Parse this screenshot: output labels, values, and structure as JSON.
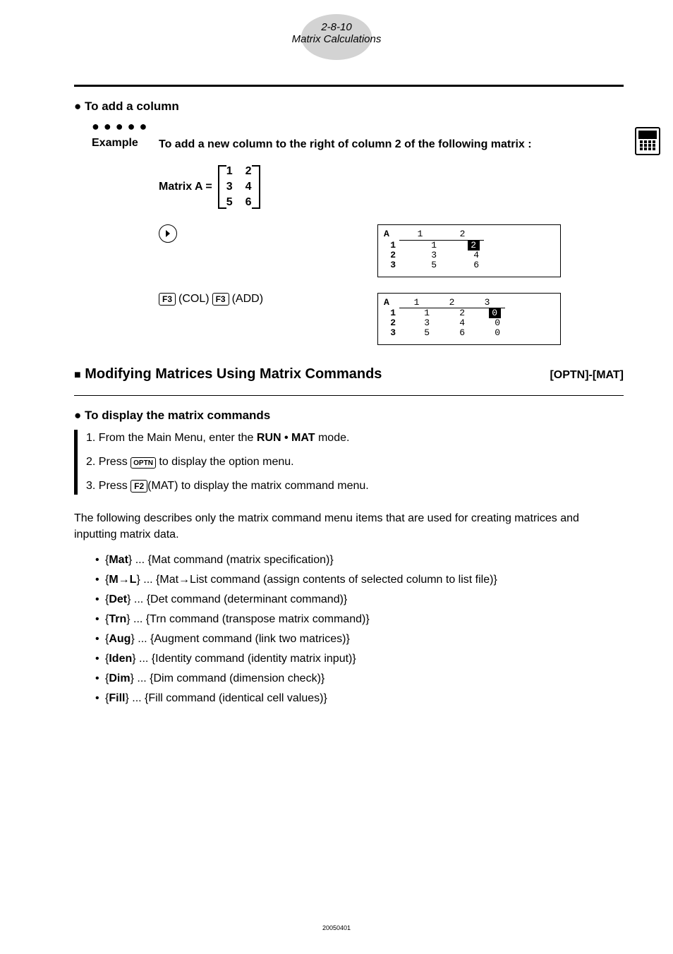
{
  "header": {
    "pageRef": "2-8-10",
    "title": "Matrix Calculations"
  },
  "section1": {
    "heading": "To add a column",
    "exampleLabel": "Example",
    "exampleText": "To add a new column to the right of column 2 of the following matrix :",
    "matrixLabel": "Matrix A =",
    "matrix": [
      [
        "1",
        "2"
      ],
      [
        "3",
        "4"
      ],
      [
        "5",
        "6"
      ]
    ],
    "step2keys": {
      "k1": "F3",
      "t1": "(COL)",
      "k2": "F3",
      "t2": "(ADD)"
    }
  },
  "screen1": {
    "label": "A",
    "cols": [
      "1",
      "2"
    ],
    "rows": [
      {
        "r": "1",
        "c": [
          "1",
          "2"
        ],
        "hl": 1
      },
      {
        "r": "2",
        "c": [
          "3",
          "4"
        ]
      },
      {
        "r": "3",
        "c": [
          "5",
          "6"
        ]
      }
    ]
  },
  "screen2": {
    "label": "A",
    "cols": [
      "1",
      "2",
      "3"
    ],
    "rows": [
      {
        "r": "1",
        "c": [
          "1",
          "2",
          "0"
        ],
        "hl": 2
      },
      {
        "r": "2",
        "c": [
          "3",
          "4",
          "0"
        ]
      },
      {
        "r": "3",
        "c": [
          "5",
          "6",
          "0"
        ]
      }
    ]
  },
  "section2": {
    "heading": "Modifying Matrices Using Matrix Commands",
    "right": "[OPTN]-[MAT]",
    "subheading": "To display the matrix commands",
    "step1a": "1. From the Main Menu, enter the ",
    "step1b": "RUN • MAT",
    "step1c": " mode.",
    "step2a": "2. Press ",
    "step2key": "OPTN",
    "step2b": " to display the option menu.",
    "step3a": "3. Press ",
    "step3key": "F2",
    "step3b": "(MAT) to display the matrix command menu.",
    "desc": "The following describes only the matrix command menu items that are used for creating matrices and inputting matrix data.",
    "commands": [
      {
        "name": "Mat",
        "desc": " ... {Mat command (matrix specification)}"
      },
      {
        "name": "M→L",
        "desc": " ... {Mat→List command (assign contents of selected column to list file)}"
      },
      {
        "name": "Det",
        "desc": " ... {Det command (determinant command)}"
      },
      {
        "name": "Trn",
        "desc": " ... {Trn command (transpose matrix command)}"
      },
      {
        "name": "Aug",
        "desc": " ... {Augment command (link two matrices)}"
      },
      {
        "name": "Iden",
        "desc": " ... {Identity command (identity matrix input)}"
      },
      {
        "name": "Dim",
        "desc": " ... {Dim command (dimension check)}"
      },
      {
        "name": "Fill",
        "desc": " ... {Fill command (identical cell values)}"
      }
    ]
  },
  "footer": "20050401"
}
